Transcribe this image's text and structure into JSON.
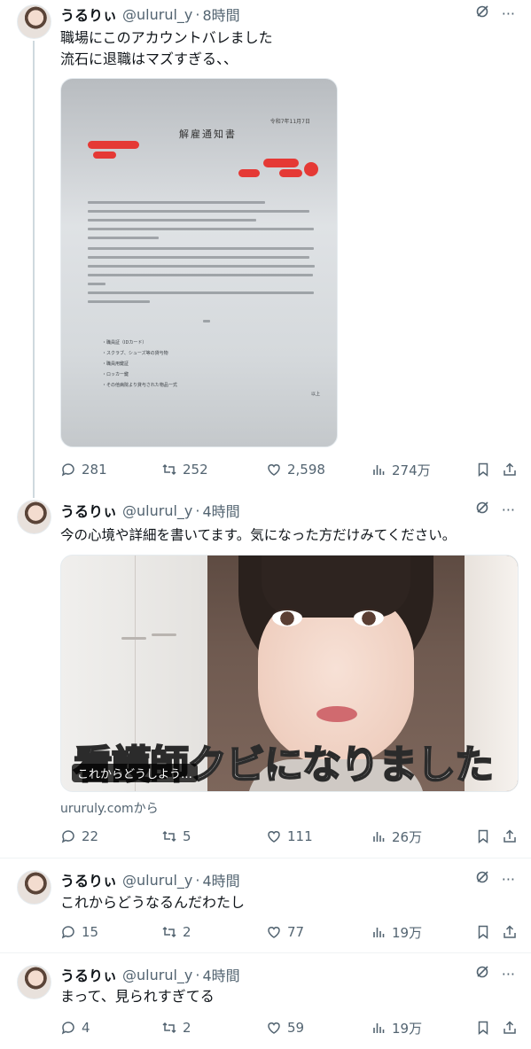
{
  "tweets": [
    {
      "name": "うるりぃ",
      "handle": "@ulurul_y",
      "time": "8時間",
      "text": "職場にこのアカウントバレました\n流石に退職はマズすぎる、、",
      "metrics": {
        "replies": "281",
        "retweets": "252",
        "likes": "2,598",
        "views": "274万"
      },
      "document": {
        "title": "解雇通知書",
        "date": "令和7年11月7日",
        "list_items": [
          "・職員証（IDカード）",
          "・スクラブ、シューズ等の貸与物",
          "・職員用鍵証",
          "・ロッカー鍵",
          "・その他病院より貸与された物品一式"
        ],
        "ijo": "以上"
      }
    },
    {
      "name": "うるりぃ",
      "handle": "@ulurul_y",
      "time": "4時間",
      "text": "今の心境や詳細を書いてます。気になった方だけみてください。",
      "video_caption_main": "看護師クビになりました",
      "video_caption_sub": "これからどうしよう…",
      "link_source": "ururuly.comから",
      "metrics": {
        "replies": "22",
        "retweets": "5",
        "likes": "111",
        "views": "26万"
      }
    },
    {
      "name": "うるりぃ",
      "handle": "@ulurul_y",
      "time": "4時間",
      "text": "これからどうなるんだわたし",
      "metrics": {
        "replies": "15",
        "retweets": "2",
        "likes": "77",
        "views": "19万"
      }
    },
    {
      "name": "うるりぃ",
      "handle": "@ulurul_y",
      "time": "4時間",
      "text": "まって、見られすぎてる",
      "metrics": {
        "replies": "4",
        "retweets": "2",
        "likes": "59",
        "views": "19万"
      }
    }
  ],
  "icons": {
    "grok": "grok-icon",
    "more": "more-icon",
    "reply": "reply-icon",
    "retweet": "retweet-icon",
    "like": "like-icon",
    "views": "views-icon",
    "bookmark": "bookmark-icon",
    "share": "share-icon"
  },
  "colors": {
    "text": "#0f1419",
    "secondary": "#536471",
    "divider": "#eff3f4",
    "thread_line": "#cfd9de"
  }
}
